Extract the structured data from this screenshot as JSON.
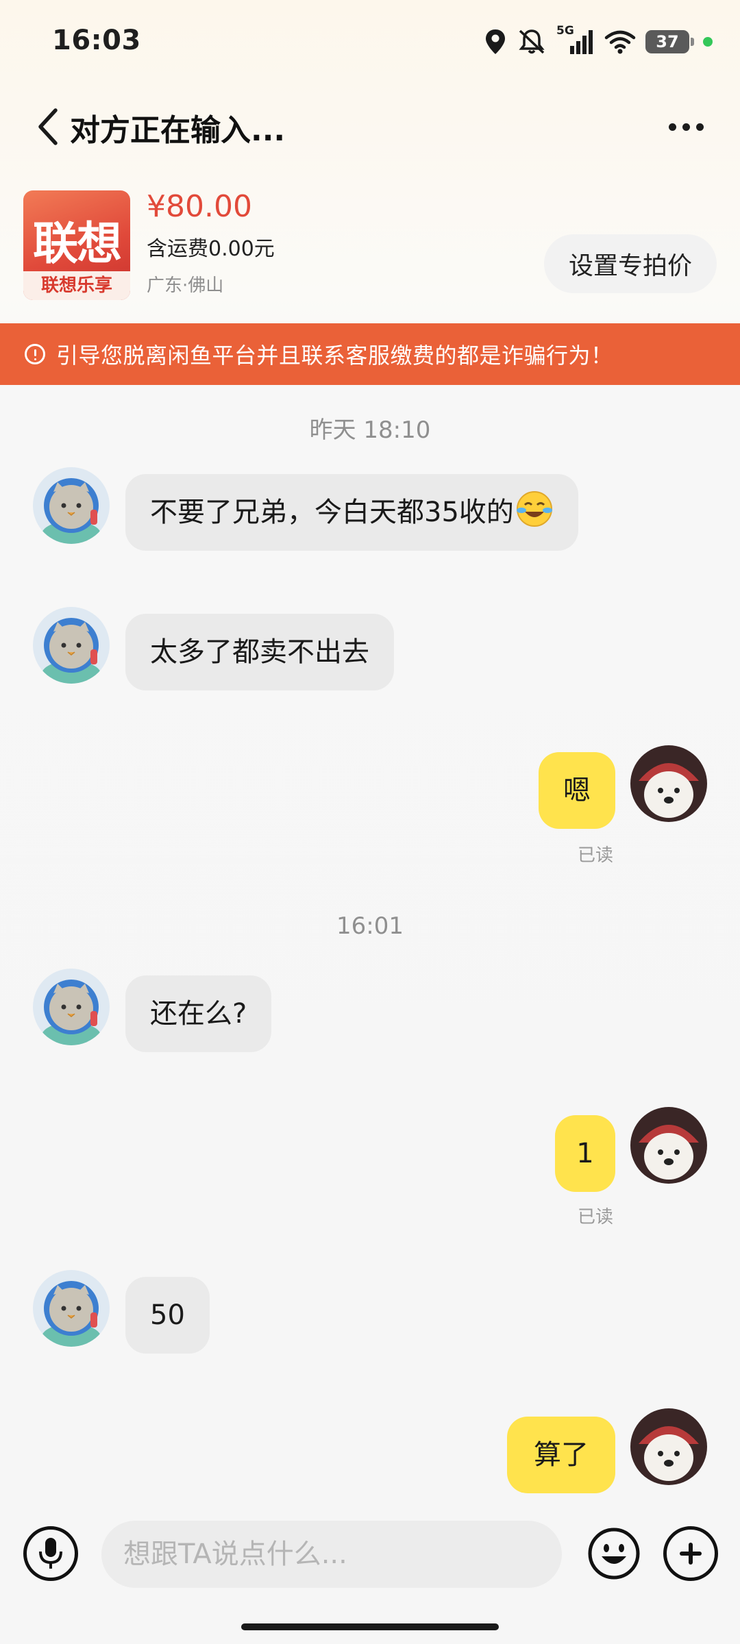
{
  "status_bar": {
    "time": "16:03",
    "network": "5G",
    "battery": "37",
    "icons": [
      "location-icon",
      "mute-icon",
      "signal-icon",
      "wifi-icon",
      "battery-icon"
    ]
  },
  "header": {
    "title": "对方正在输入...",
    "back_icon": "chevron-left-icon",
    "more_icon": "more-dots-icon"
  },
  "product": {
    "thumb_logo": "联想",
    "thumb_caption": "联想乐享",
    "price": "¥80.00",
    "shipping": "含运费0.00元",
    "location": "广东·佛山",
    "special_price_button": "设置专拍价"
  },
  "warning": {
    "text": "引导您脱离闲鱼平台并且联系客服缴费的都是诈骗行为！",
    "icon": "alert-circle-icon"
  },
  "chat": {
    "timestamp_1": "昨天 18:10",
    "msg_1": "不要了兄弟，今白天都35收的",
    "msg_2": "太多了都卖不出去",
    "msg_3": "嗯",
    "read_1": "已读",
    "timestamp_2": "16:01",
    "msg_4": "还在么?",
    "msg_5": "1",
    "read_2": "已读",
    "msg_6": "50",
    "msg_7": "算了"
  },
  "input_bar": {
    "placeholder": "想跟TA说点什么...",
    "mic_icon": "microphone-icon",
    "emoji_icon": "emoji-face-icon",
    "plus_icon": "plus-icon"
  },
  "colors": {
    "accent_price": "#e24a3a",
    "warning_bg": "#ea6138",
    "outgoing_bubble": "#ffe34d",
    "incoming_bubble": "#eaeaea"
  }
}
